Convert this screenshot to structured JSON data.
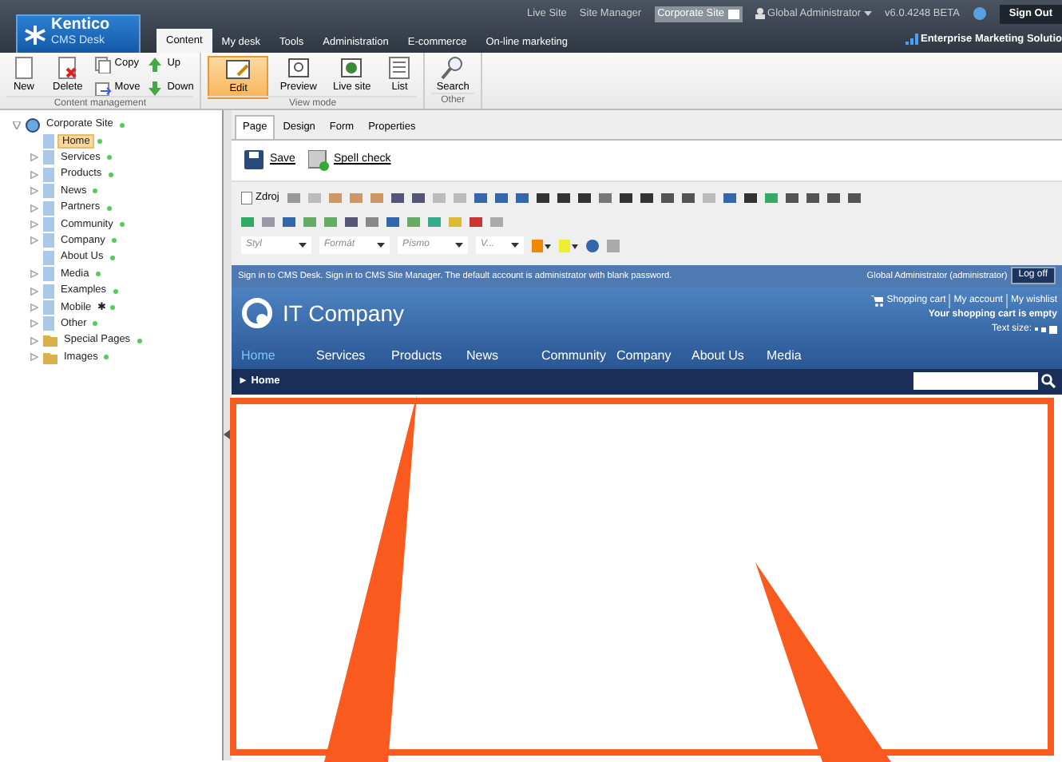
{
  "header": {
    "logo_title": "Kentico",
    "logo_subtitle": "CMS Desk",
    "tabs": [
      {
        "label": "Content",
        "selected": true
      },
      {
        "label": "My desk",
        "selected": false
      },
      {
        "label": "Tools",
        "selected": false
      },
      {
        "label": "Administration",
        "selected": false
      },
      {
        "label": "E-commerce",
        "selected": false
      },
      {
        "label": "On-line marketing",
        "selected": false
      }
    ],
    "links": [
      "Live Site",
      "Site Manager"
    ],
    "site_select": "Corporate Site",
    "user": "Global Administrator",
    "version": "v6.0.4248 BETA",
    "sign_out": "Sign Out",
    "edition": "Enterprise Marketing Solutio"
  },
  "toolbar": {
    "groups": [
      {
        "title": "Content management",
        "buttons": [
          {
            "label": "New",
            "kind": "big",
            "selected": false
          },
          {
            "label": "Delete",
            "kind": "big",
            "selected": false
          },
          {
            "label": "Copy",
            "kind": "small",
            "selected": false
          },
          {
            "label": "Move",
            "kind": "small",
            "selected": false
          },
          {
            "label": "Up",
            "kind": "small",
            "selected": false
          },
          {
            "label": "Down",
            "kind": "small",
            "selected": false
          }
        ]
      },
      {
        "title": "View mode",
        "buttons": [
          {
            "label": "Edit",
            "kind": "big",
            "selected": true
          },
          {
            "label": "Preview",
            "kind": "big",
            "selected": false
          },
          {
            "label": "Live site",
            "kind": "big",
            "selected": false
          },
          {
            "label": "List",
            "kind": "big",
            "selected": false
          }
        ]
      },
      {
        "title": "Other",
        "buttons": [
          {
            "label": "Search",
            "kind": "big",
            "selected": false
          }
        ]
      }
    ]
  },
  "tree": {
    "label": "Corporate Site",
    "expanded": true,
    "children": [
      {
        "label": "Home",
        "kind": "page",
        "selected": true,
        "has_children": false
      },
      {
        "label": "Services",
        "kind": "page",
        "selected": false,
        "has_children": true
      },
      {
        "label": "Products",
        "kind": "page",
        "selected": false,
        "has_children": true
      },
      {
        "label": "News",
        "kind": "page",
        "selected": false,
        "has_children": true
      },
      {
        "label": "Partners",
        "kind": "page",
        "selected": false,
        "has_children": true
      },
      {
        "label": "Community",
        "kind": "page",
        "selected": false,
        "has_children": true
      },
      {
        "label": "Company",
        "kind": "page",
        "selected": false,
        "has_children": true
      },
      {
        "label": "About Us",
        "kind": "page",
        "selected": false,
        "has_children": false
      },
      {
        "label": "Media",
        "kind": "page",
        "selected": false,
        "has_children": true
      },
      {
        "label": "Examples",
        "kind": "page",
        "selected": false,
        "has_children": true
      },
      {
        "label": "Mobile",
        "kind": "page",
        "selected": false,
        "has_children": true,
        "mark": "✱"
      },
      {
        "label": "Other",
        "kind": "page",
        "selected": false,
        "has_children": true
      },
      {
        "label": "Special Pages",
        "kind": "folder",
        "selected": false,
        "has_children": true
      },
      {
        "label": "Images",
        "kind": "folder",
        "selected": false,
        "has_children": true
      }
    ]
  },
  "edit_tabs": [
    {
      "label": "Page",
      "selected": true
    },
    {
      "label": "Design",
      "selected": false
    },
    {
      "label": "Form",
      "selected": false
    },
    {
      "label": "Properties",
      "selected": false
    }
  ],
  "actions": [
    "Save",
    "Spell check"
  ],
  "editor": {
    "source_button": "Zdroj",
    "dropdowns": [
      "Styl",
      "Formát",
      "Písmo",
      "V..."
    ]
  },
  "site": {
    "signin_parts": [
      "Sign in to ",
      "CMS Desk",
      ". Sign in to ",
      "CMS Site Manager",
      ". The default account is administrator with blank password."
    ],
    "user": "Global Administrator (administrator)",
    "logoff": "Log off",
    "company": "IT Company",
    "cart_links": [
      "Shopping cart",
      "My account",
      "My wishlist"
    ],
    "cart_status": "Your shopping cart is empty",
    "text_size": "Text size:",
    "menu": [
      {
        "label": "Home",
        "selected": true
      },
      {
        "label": "Services",
        "selected": false
      },
      {
        "label": "Products",
        "selected": false
      },
      {
        "label": "News",
        "selected": false
      },
      {
        "label": "Community",
        "selected": false
      },
      {
        "label": "Company",
        "selected": false
      },
      {
        "label": "About Us",
        "selected": false
      },
      {
        "label": "Media",
        "selected": false
      }
    ],
    "breadcrumb": "► Home"
  }
}
